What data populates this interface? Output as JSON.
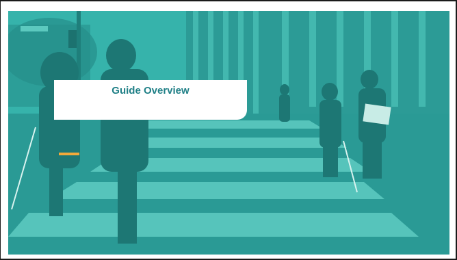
{
  "slide": {
    "title": "Guide Overview",
    "overlay_color": "#2aa9a3",
    "title_color": "#1f7f86",
    "accent_color": "#f2a93a"
  },
  "photo": {
    "subject": "people-crossing-crosswalk-with-white-canes"
  }
}
